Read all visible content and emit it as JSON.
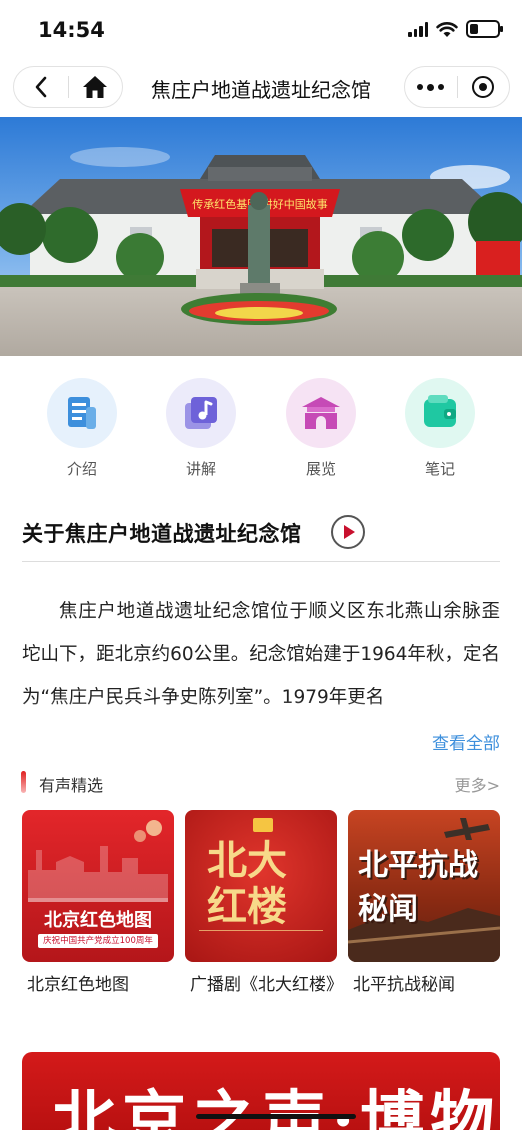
{
  "status_bar": {
    "time": "14:54"
  },
  "nav": {
    "title": "焦庄户地道战遗址纪念馆"
  },
  "menu": [
    {
      "label": "介绍",
      "icon": "document-icon",
      "color": "#3d8fdc"
    },
    {
      "label": "讲解",
      "icon": "music-note-icon",
      "color": "#6e62d9"
    },
    {
      "label": "展览",
      "icon": "pavilion-icon",
      "color": "#c64ab6"
    },
    {
      "label": "笔记",
      "icon": "wallet-icon",
      "color": "#1fc8a2"
    }
  ],
  "about": {
    "title": "关于焦庄户地道战遗址纪念馆",
    "text": "焦庄户地道战遗址纪念馆位于顺义区东北燕山余脉歪坨山下，距北京约60公里。纪念馆始建于1964年秋，定名为“焦庄户民兵斗争史陈列室”。1979年更名",
    "view_all": "查看全部"
  },
  "audio": {
    "title": "有声精选",
    "more": "更多>",
    "cards": [
      {
        "title": "北京红色地图",
        "cover_title": "北京红色地图",
        "cover_sub": "庆祝中国共产党成立100周年"
      },
      {
        "title": "广播剧《北大红楼》",
        "cover_title": "北大红楼"
      },
      {
        "title": "北平抗战秘闻",
        "cover_title": "北平抗战秘闻"
      }
    ]
  },
  "banner": {
    "text": "北京之声·博物馆"
  },
  "hero": {
    "banner_text": "传承红色基因 讲好中国故事"
  },
  "colors": {
    "accent_red": "#c8102e",
    "link_blue": "#3d8fdc"
  }
}
